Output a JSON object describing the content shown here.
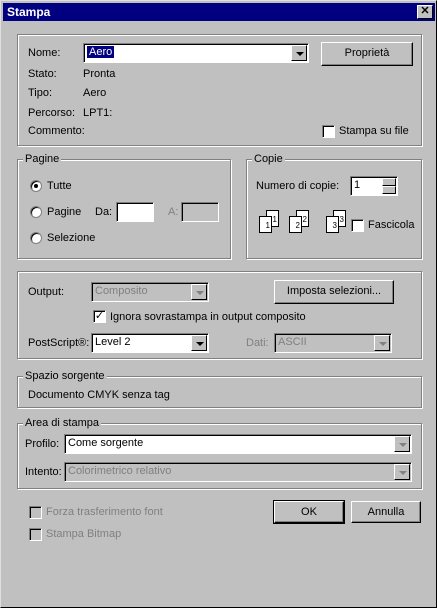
{
  "window": {
    "title": "Stampa",
    "close": "✕"
  },
  "printer": {
    "name_label": "Nome:",
    "name_value": "Aero",
    "properties_button": "Proprietà",
    "status_label": "Stato:",
    "status_value": "Pronta",
    "type_label": "Tipo:",
    "type_value": "Aero",
    "path_label": "Percorso:",
    "path_value": "LPT1:",
    "comment_label": "Commento:",
    "print_to_file": "Stampa su file",
    "print_to_file_checked": false
  },
  "pages": {
    "group_label": "Pagine",
    "all": "Tutte",
    "pages": "Pagine",
    "from": "Da:",
    "to": "A:",
    "from_value": "",
    "to_value": "",
    "selection": "Selezione",
    "selected": "all"
  },
  "copies": {
    "group_label": "Copie",
    "count_label": "Numero di copie:",
    "count_value": "1",
    "collate": "Fascicola",
    "collate_checked": false,
    "page_numbers": [
      "1",
      "1",
      "2",
      "2",
      "3",
      "3"
    ]
  },
  "output": {
    "output_label": "Output:",
    "output_value": "Composito",
    "setup_button": "Imposta selezioni...",
    "ignore_overprint": "Ignora sovrastampa in output composito",
    "ignore_overprint_checked": true,
    "postscript_label": "PostScript®:",
    "postscript_value": "Level 2",
    "data_label": "Dati:",
    "data_value": "ASCII"
  },
  "source_space": {
    "group_label": "Spazio sorgente",
    "value": "Documento CMYK senza tag"
  },
  "print_space": {
    "group_label": "Area di stampa",
    "profile_label": "Profilo:",
    "profile_value": "Come sorgente",
    "intent_label": "Intento:",
    "intent_value": "Colorimetrico relativo"
  },
  "footer": {
    "force_font": "Forza trasferimento font",
    "bitmap": "Stampa Bitmap",
    "ok": "OK",
    "cancel": "Annulla"
  }
}
